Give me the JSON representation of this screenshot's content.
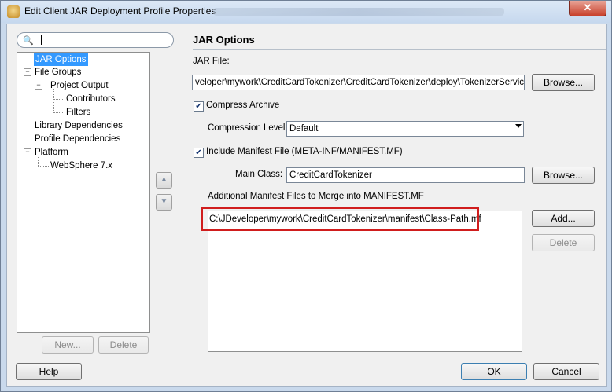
{
  "window": {
    "title": "Edit Client JAR Deployment Profile Properties",
    "close_glyph": "✕"
  },
  "search": {
    "value": ""
  },
  "tree": {
    "items": [
      {
        "label": "JAR Options"
      },
      {
        "label": "File Groups"
      },
      {
        "label": "Project Output"
      },
      {
        "label": "Contributors"
      },
      {
        "label": "Filters"
      },
      {
        "label": "Library Dependencies"
      },
      {
        "label": "Profile Dependencies"
      },
      {
        "label": "Platform"
      },
      {
        "label": "WebSphere 7.x"
      }
    ]
  },
  "left_buttons": {
    "new": "New...",
    "delete": "Delete"
  },
  "panel": {
    "title": "JAR Options",
    "jar_file_label": "JAR File:",
    "jar_file_value": "veloper\\mywork\\CreditCardTokenizer\\CreditCardTokenizer\\deploy\\TokenizerService.jar",
    "browse": "Browse...",
    "compress_label": "Compress Archive",
    "compress_checked": true,
    "compression_level_label": "Compression Level",
    "compression_level_value": "Default",
    "include_manifest_label": "Include Manifest File (META-INF/MANIFEST.MF)",
    "include_manifest_checked": true,
    "main_class_label": "Main Class:",
    "main_class_value": "CreditCardTokenizer",
    "browse2": "Browse...",
    "additional_label": "Additional Manifest Files to Merge into MANIFEST.MF",
    "manifest_files": [
      "C:\\JDeveloper\\mywork\\CreditCardTokenizer\\manifest\\Class-Path.mf"
    ],
    "add": "Add...",
    "delete": "Delete"
  },
  "footer": {
    "help": "Help",
    "ok": "OK",
    "cancel": "Cancel"
  },
  "colors": {
    "selection": "#3399ff",
    "highlight_box": "#d01d1d",
    "titlebar": "#c6d8ee"
  }
}
